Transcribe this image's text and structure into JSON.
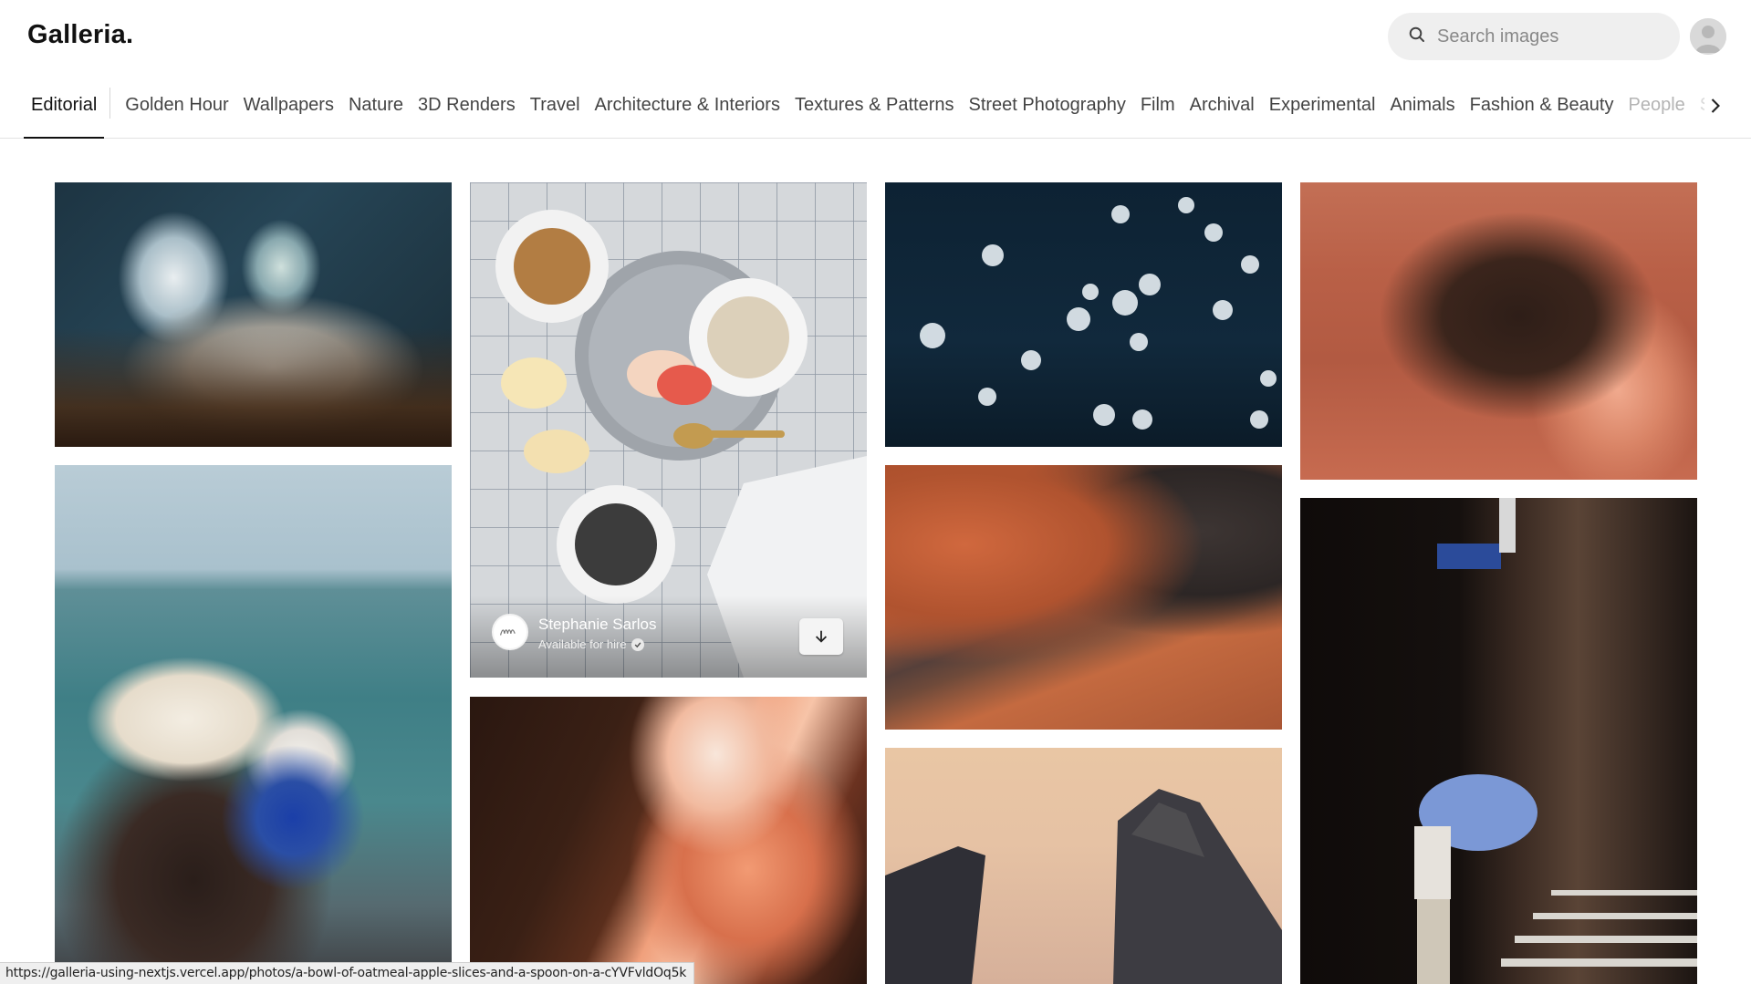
{
  "app": {
    "logo": "Galleria."
  },
  "search": {
    "placeholder": "Search images",
    "icon": "search-icon"
  },
  "user": {
    "avatar_icon": "user-avatar-icon"
  },
  "categories": {
    "active": "Editorial",
    "items": [
      "Editorial",
      "Golden Hour",
      "Wallpapers",
      "Nature",
      "3D Renders",
      "Travel",
      "Architecture & Interiors",
      "Textures & Patterns",
      "Street Photography",
      "Film",
      "Archival",
      "Experimental",
      "Animals",
      "Fashion & Beauty",
      "People",
      "Sp"
    ],
    "next_icon": "chevron-right-icon"
  },
  "photos": [
    {
      "subject": "bedroom interior",
      "column": 1
    },
    {
      "subject": "woman in sun hat with dog by the sea",
      "column": 1
    },
    {
      "subject": "bowl of oatmeal, apple slices and a spoon",
      "column": 2,
      "hovered": true
    },
    {
      "subject": "slot canyon",
      "column": 2
    },
    {
      "subject": "jellyfish",
      "column": 3
    },
    {
      "subject": "sand dune",
      "column": 3
    },
    {
      "subject": "skyscrapers",
      "column": 3
    },
    {
      "subject": "canyon aerial",
      "column": 4
    },
    {
      "subject": "person with blue umbrella",
      "column": 4
    }
  ],
  "overlay": {
    "author_name": "Stephanie Sarlos",
    "author_status": "Available for hire",
    "verified_icon": "verified-check-icon",
    "download_icon": "download-arrow-icon"
  },
  "status_bar": {
    "url": "https://galleria-using-nextjs.vercel.app/photos/a-bowl-of-oatmeal-apple-slices-and-a-spoon-on-a-cYVFvldOq5k"
  },
  "colors": {
    "active_tab": "#111111",
    "tab_text": "#444444",
    "search_bg": "#efefef"
  }
}
